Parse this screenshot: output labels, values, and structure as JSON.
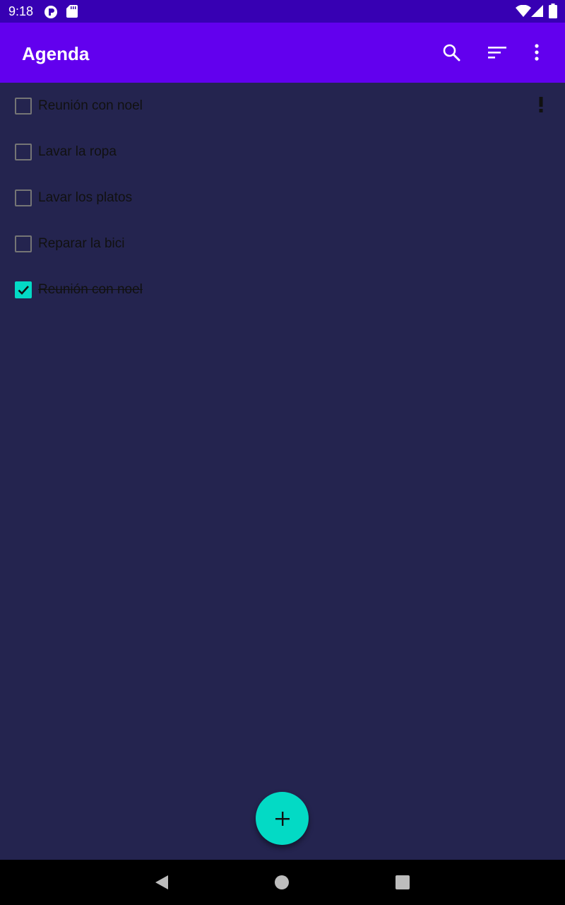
{
  "status_bar": {
    "time": "9:18",
    "left_icons": [
      "app-notification-icon",
      "sd-card-icon"
    ],
    "right_icons": [
      "wifi-icon",
      "cell-signal-icon",
      "battery-icon"
    ]
  },
  "app_bar": {
    "title": "Agenda",
    "actions": [
      "search-icon",
      "sort-icon",
      "more-vert-icon"
    ]
  },
  "tasks": [
    {
      "label": "Reunión con noel",
      "checked": false,
      "priority": true
    },
    {
      "label": "Lavar la ropa",
      "checked": false,
      "priority": false
    },
    {
      "label": "Lavar los platos",
      "checked": false,
      "priority": false
    },
    {
      "label": "Reparar la bici",
      "checked": false,
      "priority": false
    },
    {
      "label": "Reunión con noel",
      "checked": true,
      "priority": false
    }
  ],
  "fab": {
    "icon": "add-icon"
  },
  "nav_bar": {
    "buttons": [
      "back-icon",
      "home-icon",
      "recents-icon"
    ]
  },
  "colors": {
    "status_bar": "#3700b3",
    "app_bar": "#6200ee",
    "background": "#24244f",
    "accent": "#03dac5",
    "text": "#111111"
  }
}
